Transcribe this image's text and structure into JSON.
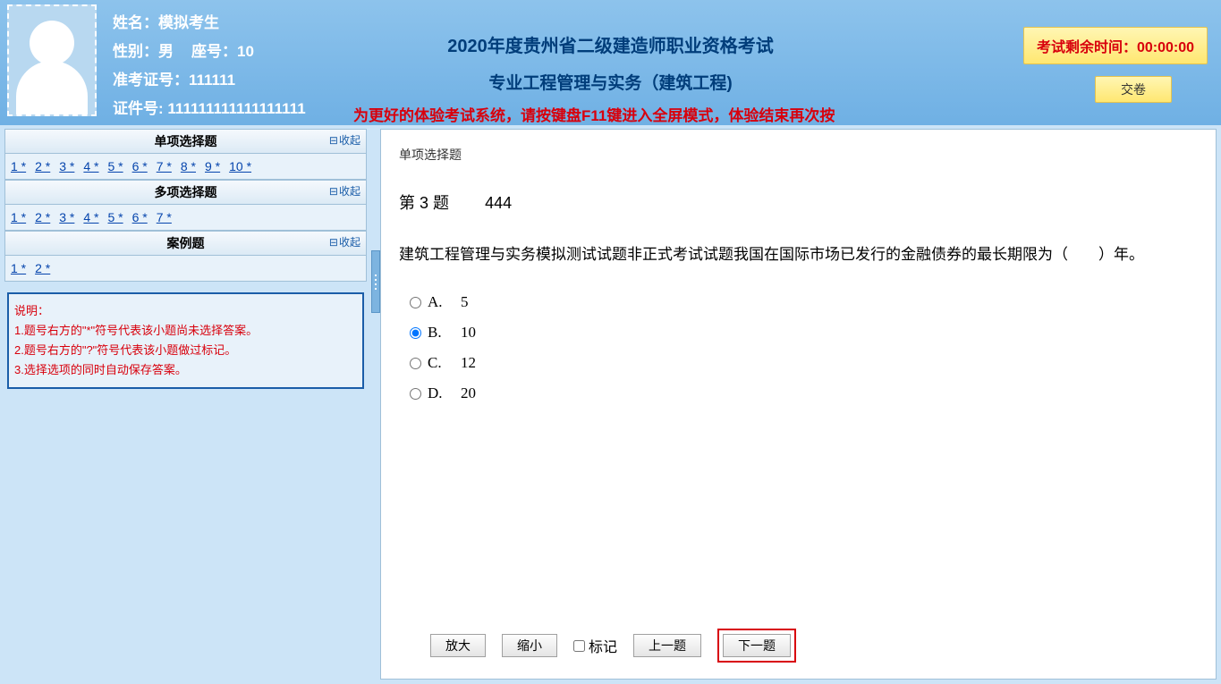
{
  "candidate": {
    "name_label": "姓名：",
    "name_value": "模拟考生",
    "gender_label": "性别：",
    "gender_value": "男",
    "seat_label": "座号：",
    "seat_value": "10",
    "admission_label": "准考证号：",
    "admission_value": "111111",
    "id_label": "证件号:",
    "id_value": "111111111111111111"
  },
  "exam": {
    "title_line1": "2020年度贵州省二级建造师职业资格考试",
    "title_line2": "专业工程管理与实务（建筑工程)"
  },
  "timer": {
    "label": "考试剩余时间：",
    "value": "00:00:00"
  },
  "buttons": {
    "submit": "交卷",
    "zoom_in": "放大",
    "zoom_out": "缩小",
    "mark": "标记",
    "prev": "上一题",
    "next": "下一题"
  },
  "notice": "为更好的体验考试系统，请按键盘F11键进入全屏模式，体验结束再次按",
  "sections": {
    "single": {
      "title": "单项选择题",
      "collapse": "收起",
      "items": [
        "1 *",
        "2 *",
        "3 *",
        "4 *",
        "5 *",
        "6 *",
        "7 *",
        "8 *",
        "9 *",
        "10 *"
      ]
    },
    "multi": {
      "title": "多项选择题",
      "collapse": "收起",
      "items": [
        "1 *",
        "2 *",
        "3 *",
        "4 *",
        "5 *",
        "6 *",
        "7 *"
      ]
    },
    "case": {
      "title": "案例题",
      "collapse": "收起",
      "items": [
        "1 *",
        "2 *"
      ]
    }
  },
  "instructions": {
    "title": "说明：",
    "line1": "1.题号右方的\"*\"符号代表该小题尚未选择答案。",
    "line2": "2.题号右方的\"?\"符号代表该小题做过标记。",
    "line3": "3.选择选项的同时自动保存答案。"
  },
  "question": {
    "type_label": "单项选择题",
    "header_prefix": "第",
    "number": "3",
    "header_suffix": "题",
    "code": "444",
    "text": "建筑工程管理与实务模拟测试试题非正式考试试题我国在国际市场已发行的金融债券的最长期限为（　　）年。",
    "options": [
      {
        "label": "A.",
        "text": "5",
        "selected": false
      },
      {
        "label": "B.",
        "text": "10",
        "selected": true
      },
      {
        "label": "C.",
        "text": "12",
        "selected": false
      },
      {
        "label": "D.",
        "text": "20",
        "selected": false
      }
    ]
  }
}
